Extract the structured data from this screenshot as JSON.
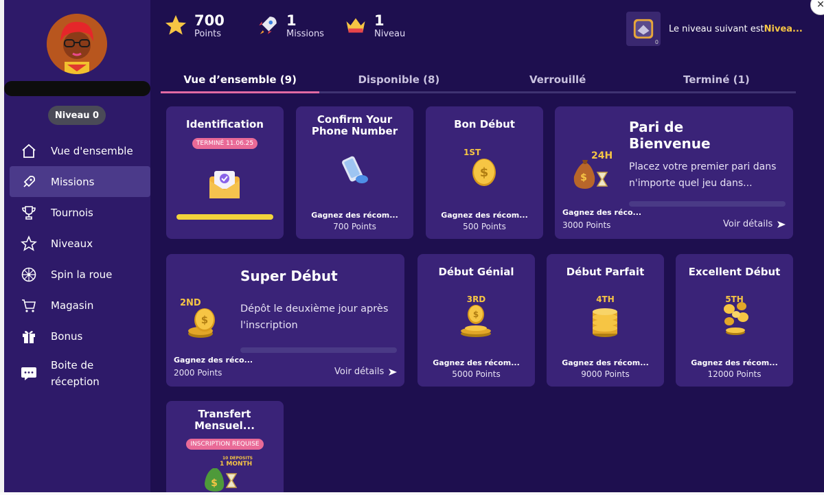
{
  "sidebar": {
    "level_label": "Niveau 0",
    "items": [
      {
        "label": "Vue d'ensemble",
        "icon": "home-icon"
      },
      {
        "label": "Missions",
        "icon": "rocket-icon"
      },
      {
        "label": "Tournois",
        "icon": "trophy-icon"
      },
      {
        "label": "Niveaux",
        "icon": "star-icon"
      },
      {
        "label": "Spin la roue",
        "icon": "wheel-icon"
      },
      {
        "label": "Magasin",
        "icon": "cart-icon"
      },
      {
        "label": "Bonus",
        "icon": "gift-icon"
      },
      {
        "label": "Boite de réception",
        "icon": "chat-icon"
      }
    ]
  },
  "stats": {
    "points": {
      "value": "700",
      "label": "Points"
    },
    "missions": {
      "value": "1",
      "label": "Missions"
    },
    "level": {
      "value": "1",
      "label": "Niveau"
    }
  },
  "next_level": {
    "prefix": "Le niveau suivant est ",
    "highlight": "Nivea...",
    "count": "0"
  },
  "tabs": [
    {
      "label": "Vue d’ensemble (9)"
    },
    {
      "label": "Disponible (8)"
    },
    {
      "label": "Verrouillé"
    },
    {
      "label": "Terminé (1)"
    }
  ],
  "cards": {
    "identification": {
      "title": "Identification",
      "badge": "TERMINÉ 11.06.25",
      "progress": 1.0
    },
    "phone": {
      "title": "Confirm Your Phone Number",
      "reward_label": "Gagnez des récom...",
      "reward_points": "700 Points"
    },
    "bon_debut": {
      "title": "Bon Début",
      "rank": "1ST",
      "reward_label": "Gagnez des récom...",
      "reward_points": "500 Points"
    },
    "pari": {
      "title": "Pari de Bienvenue",
      "tag": "24H",
      "desc": "Placez votre premier pari dans n'importe quel jeu dans...",
      "reward_label": "Gagnez des réco...",
      "reward_points": "3000 Points",
      "details": "Voir détails",
      "progress": 0.0
    },
    "super_debut": {
      "title": "Super Début",
      "rank": "2ND",
      "desc": "Dépôt le deuxième jour après l'inscription",
      "reward_label": "Gagnez des réco...",
      "reward_points": "2000 Points",
      "details": "Voir détails",
      "progress": 0.0
    },
    "debut_genial": {
      "title": "Début Génial",
      "rank": "3RD",
      "reward_label": "Gagnez des récom...",
      "reward_points": "5000 Points"
    },
    "debut_parfait": {
      "title": "Début Parfait",
      "rank": "4TH",
      "reward_label": "Gagnez des récom...",
      "reward_points": "9000 Points"
    },
    "excellent_debut": {
      "title": "Excellent Début",
      "rank": "5TH",
      "reward_label": "Gagnez des récom...",
      "reward_points": "12000 Points"
    },
    "transfert": {
      "title": "Transfert Mensuel...",
      "badge": "INSCRIPTION REQUISE",
      "art_line1": "10 DEPOSITS",
      "art_line2": "1 MONTH"
    }
  },
  "close_label": "✕"
}
